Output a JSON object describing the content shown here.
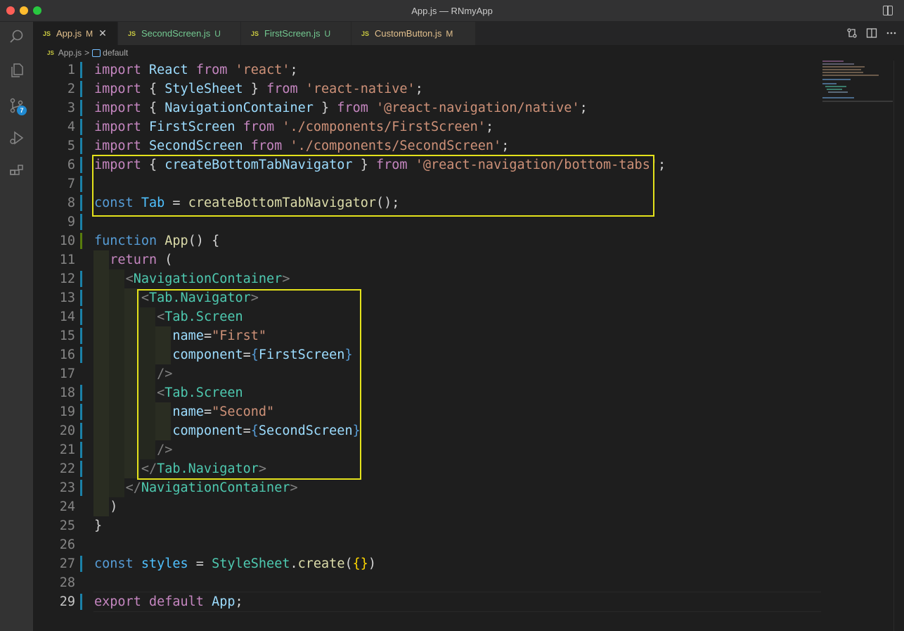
{
  "window": {
    "title": "App.js — RNmyApp"
  },
  "activity": [
    "search-icon",
    "files-icon",
    "source-control-icon",
    "run-debug-icon",
    "extensions-icon"
  ],
  "scm_badge": "7",
  "tabs": [
    {
      "icon": "JS",
      "name": "App.js",
      "status": "M",
      "active": true
    },
    {
      "icon": "JS",
      "name": "SecondScreen.js",
      "status": "U"
    },
    {
      "icon": "JS",
      "name": "FirstScreen.js",
      "status": "U"
    },
    {
      "icon": "JS",
      "name": "CustomButton.js",
      "status": "M"
    }
  ],
  "breadcrumb": {
    "file": "App.js",
    "sep": ">",
    "symbol": "default"
  },
  "code": [
    {
      "n": "1"
    },
    {
      "n": "2"
    },
    {
      "n": "3"
    },
    {
      "n": "4"
    },
    {
      "n": "5"
    },
    {
      "n": "6"
    },
    {
      "n": "7"
    },
    {
      "n": "8"
    },
    {
      "n": "9"
    },
    {
      "n": "10"
    },
    {
      "n": "11"
    },
    {
      "n": "12"
    },
    {
      "n": "13"
    },
    {
      "n": "14"
    },
    {
      "n": "15"
    },
    {
      "n": "16"
    },
    {
      "n": "17"
    },
    {
      "n": "18"
    },
    {
      "n": "19"
    },
    {
      "n": "20"
    },
    {
      "n": "21"
    },
    {
      "n": "22"
    },
    {
      "n": "23"
    },
    {
      "n": "24"
    },
    {
      "n": "25"
    },
    {
      "n": "26"
    },
    {
      "n": "27"
    },
    {
      "n": "28"
    },
    {
      "n": "29"
    }
  ],
  "colors": {
    "highlight_box": "#e4e21b",
    "accent": "#1f8ad2"
  }
}
